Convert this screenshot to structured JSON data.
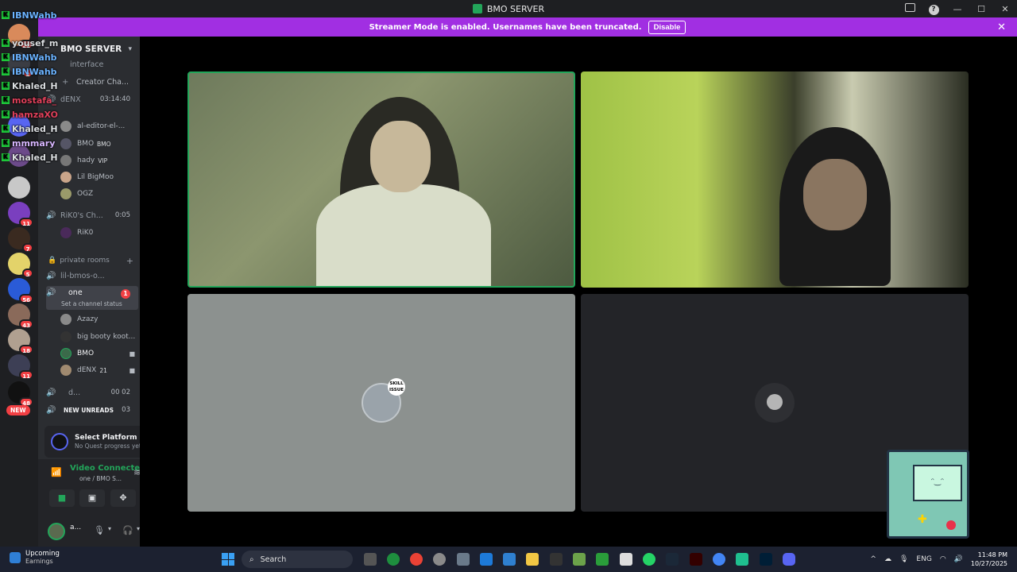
{
  "window": {
    "title": "BMO SERVER",
    "controls": {
      "minimize": "—",
      "maximize": "☐",
      "close": "✕"
    }
  },
  "banner": {
    "message": "Streamer Mode is enabled. Usernames have been truncated.",
    "button": "Disable",
    "close": "✕"
  },
  "overlay_names": [
    {
      "name": "IBNWahb",
      "color": "#6bb3ff"
    },
    {
      "name": "yousef_m",
      "color": "#ffffff"
    },
    {
      "name": "IBNWahb",
      "color": "#6bb3ff"
    },
    {
      "name": "IBNWahb",
      "color": "#6bb3ff"
    },
    {
      "name": "Khaled_H",
      "color": "#ffffff"
    },
    {
      "name": "mostafa_",
      "color": "#e0405a"
    },
    {
      "name": "hamzaXO",
      "color": "#e0405a"
    },
    {
      "name": "Khaled_H",
      "color": "#ffffff"
    },
    {
      "name": "mmmary",
      "color": "#d8b7ff"
    },
    {
      "name": "Khaled_H",
      "color": "#ffffff"
    }
  ],
  "rail": {
    "badges": [
      "22",
      "2",
      "11",
      "7",
      "5",
      "56",
      "43",
      "18",
      "11",
      "48"
    ],
    "new_pill": "NEW"
  },
  "sidebar": {
    "server_name": "BMO SERVER",
    "channels": [
      {
        "name": "interface"
      },
      {
        "name": "Creator Cha..."
      },
      {
        "name": "dENX",
        "time": "03:14:40"
      },
      {
        "name": "al-editor-el-..."
      },
      {
        "name": "RiK0's Ch...",
        "time": "0:05"
      },
      {
        "name": "lil-bmos-o..."
      },
      {
        "name": "one",
        "badge": "1",
        "status": "Set a channel status"
      },
      {
        "name": "d...",
        "time": "00 02"
      },
      {
        "name": "NEW UNREADS",
        "time": "03"
      }
    ],
    "users": [
      {
        "name": "BMO",
        "tag": "BMO"
      },
      {
        "name": "hady",
        "tag": "VIP"
      },
      {
        "name": "Lil BigMoo"
      },
      {
        "name": "OGZ"
      },
      {
        "name": "RiK0"
      },
      {
        "name": "Azazy"
      },
      {
        "name": "big booty koot..."
      },
      {
        "name": "BMO"
      },
      {
        "name": "dENX",
        "tag": "21"
      }
    ],
    "category": "private rooms"
  },
  "quest": {
    "title": "Select Platform",
    "subtitle": "No Quest progress yet"
  },
  "voice": {
    "status": "Video Connecte",
    "channel": "one / BMO S..."
  },
  "me": {
    "name": "a..."
  },
  "stage": {
    "skill_text": "SKILL ISSUE"
  },
  "taskbar": {
    "weather_title": "Upcoming",
    "weather_sub": "Earnings",
    "search": "Search",
    "lang": "ENG",
    "time": "11:48 PM",
    "date": "10/27/2025"
  }
}
